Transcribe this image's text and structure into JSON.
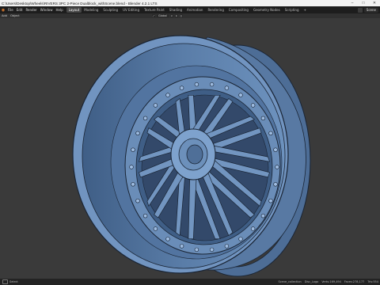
{
  "window": {
    "title": "C:\\Users\\Desktop\\Wheels\\RIVERS 3PC 2-Piece Dualblock_withScene.blend - Blender 4.2.1 LTS",
    "controls": [
      "–",
      "□",
      "✕"
    ]
  },
  "menubar": {
    "items": [
      "File",
      "Edit",
      "Render",
      "Window",
      "Help"
    ],
    "tabs": [
      "Layout",
      "Modeling",
      "Sculpting",
      "UV Editing",
      "Texture Paint",
      "Shading",
      "Animation",
      "Rendering",
      "Compositing",
      "Geometry Nodes",
      "Scripting"
    ],
    "active_tab": "Layout",
    "add_tab": "+",
    "scene_label": "Scene"
  },
  "viewport_header": {
    "items": [
      "Add",
      "Object"
    ],
    "orientation": "Global"
  },
  "statusbar": {
    "left_label": "Select",
    "right_items": [
      "Scene_collection",
      "Disc_Logo",
      "Verts:169,494",
      "Faces:278,177",
      "Tris:554"
    ]
  },
  "colors": {
    "wheel": "#6a8db8",
    "wheel_dark": "#4e6f99",
    "wheel_light": "#8fb0d6",
    "outline": "#1a2535",
    "viewport_bg": "#3a3a3a"
  }
}
